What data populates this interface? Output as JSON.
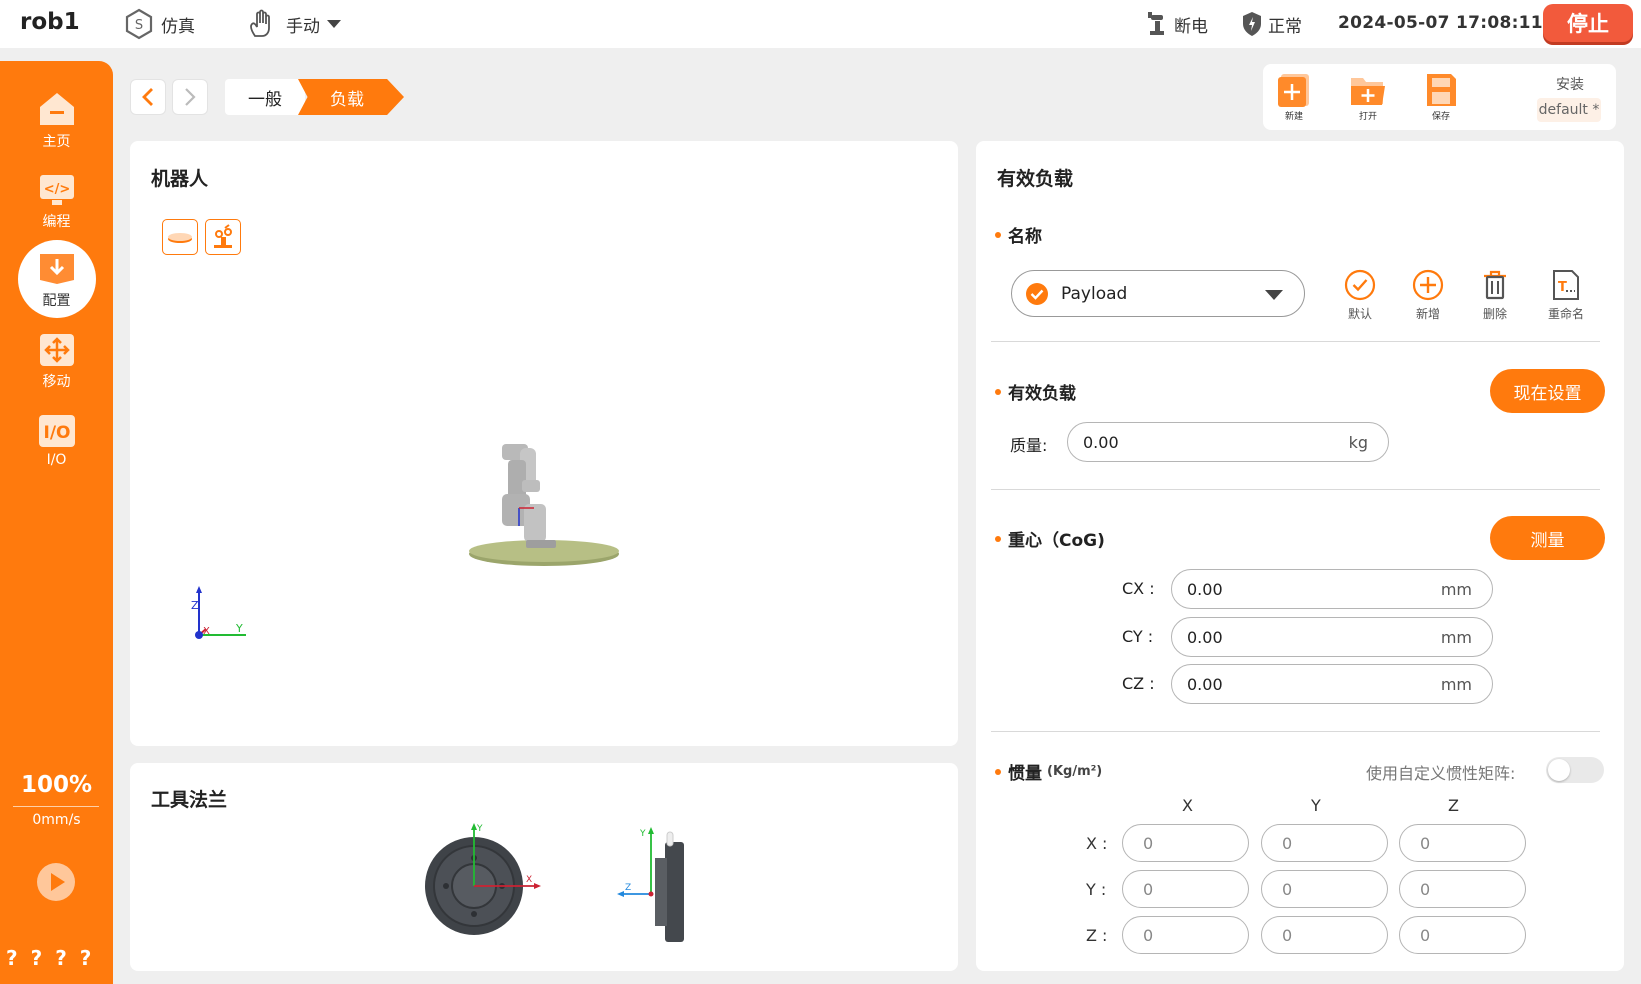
{
  "topbar": {
    "robot_name": "rob1",
    "mode_sim": "仿真",
    "mode_manual": "手动",
    "power_status": "断电",
    "safety_status": "正常",
    "datetime": "2024-05-07 17:08:11",
    "stop_label": "停止"
  },
  "sidebar": {
    "items": [
      {
        "label": "主页",
        "icon": "home-icon"
      },
      {
        "label": "编程",
        "icon": "code-icon"
      },
      {
        "label": "配置",
        "icon": "config-icon"
      },
      {
        "label": "移动",
        "icon": "move-icon"
      },
      {
        "label": "I/O",
        "icon": "io-icon"
      }
    ],
    "speed_percent": "100%",
    "speed_value": "0mm/s",
    "footer_marks": "????"
  },
  "breadcrumb": {
    "items": [
      "一般",
      "负载"
    ]
  },
  "filebar": {
    "new_label": "新建",
    "open_label": "打开",
    "save_label": "保存",
    "install_label": "安装",
    "install_value": "default *"
  },
  "robot_panel": {
    "title": "机器人"
  },
  "flange_panel": {
    "title": "工具法兰"
  },
  "payload_panel": {
    "title": "有效负载",
    "name_section": "名称",
    "selected_payload": "Payload",
    "actions": {
      "default": "默认",
      "add": "新增",
      "delete": "删除",
      "rename": "重命名"
    },
    "payload_section": "有效负载",
    "set_now_label": "现在设置",
    "mass_label": "质量:",
    "mass_value": "0.00",
    "mass_unit": "kg",
    "cog_section": "重心（CoG)",
    "measure_label": "测量",
    "cog": {
      "cx_label": "CX :",
      "cx_value": "0.00",
      "cy_label": "CY :",
      "cy_value": "0.00",
      "cz_label": "CZ :",
      "cz_value": "0.00",
      "unit": "mm"
    },
    "inertia_section": "惯量",
    "inertia_unit": "(Kg/m²)",
    "custom_matrix_label": "使用自定义惯性矩阵:",
    "custom_matrix_enabled": false,
    "columns": [
      "X",
      "Y",
      "Z"
    ],
    "rows": [
      {
        "label": "X :",
        "values": [
          "0",
          "0",
          "0"
        ]
      },
      {
        "label": "Y :",
        "values": [
          "0",
          "0",
          "0"
        ]
      },
      {
        "label": "Z :",
        "values": [
          "0",
          "0",
          "0"
        ]
      }
    ]
  },
  "colors": {
    "accent": "#ff7a0d",
    "stop": "#f25a3c"
  }
}
